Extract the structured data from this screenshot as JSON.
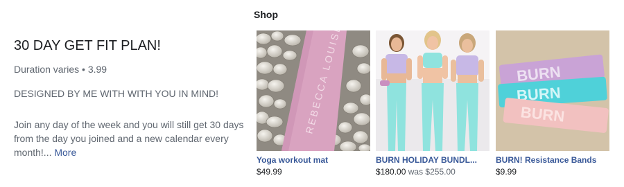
{
  "offer": {
    "title": "30 DAY GET FIT PLAN!",
    "meta": "Duration varies • 3.99",
    "tagline": "DESIGNED BY ME WITH WITH YOU IN MIND!",
    "description": "Join any day of the week and you will still get 30 days from the day you joined and a new calendar every month!...",
    "more_label": "More"
  },
  "shop": {
    "heading": "Shop",
    "products": [
      {
        "name": "Yoga workout mat",
        "price": "$49.99",
        "mat_print": "REBECCA LOUISE"
      },
      {
        "name": "BURN HOLIDAY BUNDL...",
        "price": "$180.00",
        "was_prefix": "was",
        "was_price": "$255.00"
      },
      {
        "name": "BURN! Resistance Bands",
        "price": "$9.99",
        "band_labels": [
          "BURN",
          "BURN",
          "BURN"
        ]
      }
    ]
  },
  "colors": {
    "link": "#385898",
    "muted_text": "#606770",
    "primary_text": "#1c1e21",
    "mat_pink": "#d9a3c0",
    "band_lilac": "#c9a3d6",
    "band_teal": "#4fd1d9",
    "band_pink": "#f2c1c0"
  }
}
